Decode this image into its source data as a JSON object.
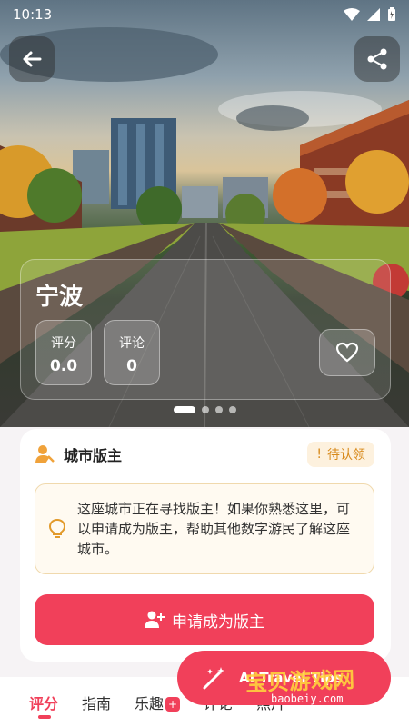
{
  "status_bar": {
    "time": "10:13"
  },
  "city": {
    "name": "宁波",
    "rating_label": "评分",
    "rating_value": "0.0",
    "comments_label": "评论",
    "comments_value": "0"
  },
  "carousel": {
    "count": 4,
    "active": 0
  },
  "moderator": {
    "title": "城市版主",
    "badge": "待认领",
    "notice": "这座城市正在寻找版主！如果你熟悉这里，可以申请成为版主，帮助其他数字游民了解这座城市。",
    "apply_button": "申请成为版主"
  },
  "tabs": [
    {
      "label": "评分",
      "active": true
    },
    {
      "label": "指南"
    },
    {
      "label": "乐趣"
    },
    {
      "label": "评论"
    },
    {
      "label": "照片"
    }
  ],
  "floating": {
    "label": "AI Travel Tips"
  },
  "watermark": {
    "text": "宝贝游戏网",
    "domain": "baobeiy.com"
  },
  "colors": {
    "accent": "#f1405a",
    "badge_text": "#d88a1b"
  }
}
